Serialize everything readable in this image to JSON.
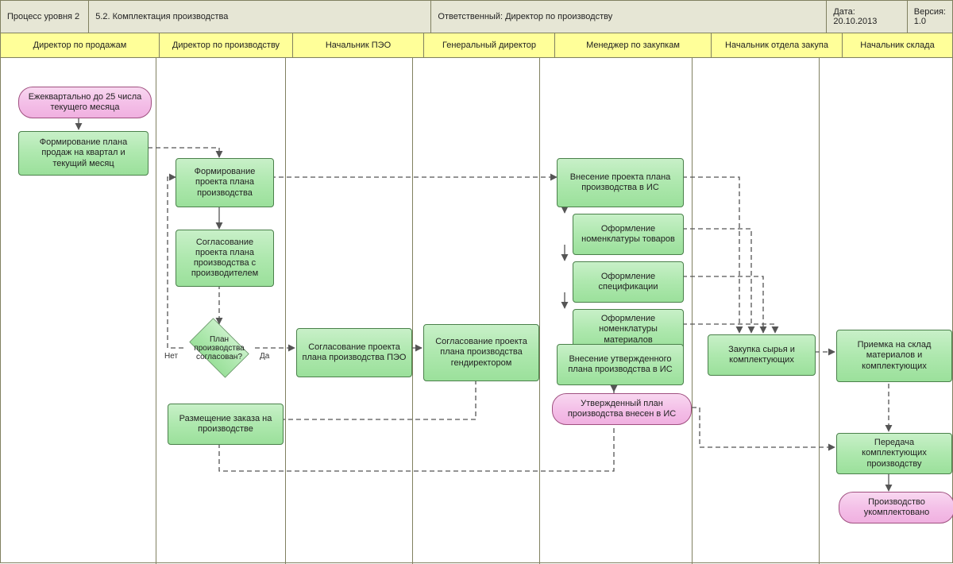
{
  "header": {
    "process_level_label": "Процесс уровня 2",
    "process_title": "5.2.  Комплектация производства",
    "responsible_label": "Ответственный: Директор по производству",
    "date_label": "Дата:",
    "date_value": "20.10.2013",
    "version_label": "Версия:",
    "version_value": "1.0"
  },
  "lanes": {
    "l0": "Директор по продажам",
    "l1": "Директор по производству",
    "l2": "Начальник ПЭО",
    "l3": "Генеральный директор",
    "l4": "Менеджер по закупкам",
    "l5": "Начальник отдела закупа",
    "l6": "Начальник склада"
  },
  "nodes": {
    "start_event": "Ежеквартально до 25 числа текущего месяца",
    "a_sales_plan": "Формирование плана продаж на квартал и текущий месяц",
    "b_project_plan": "Формирование проекта плана производства",
    "c_agree_producer": "Согласование проекта плана производства с производителем",
    "d_decision": "План производства согласован?",
    "d_yes": "Да",
    "d_no": "Нет",
    "e_place_order": "Размещение заказа на производстве",
    "f_agree_peo": "Согласование проекта плана производства ПЭО",
    "g_agree_gendir": "Согласование проекта плана производства гендиректором",
    "h_enter_project_is": "Внесение проекта плана производства в ИС",
    "i_nomenkl_goods": "Оформление номенклатуры товаров",
    "j_spec": "Оформление спецификации",
    "k_nomenkl_mat": "Оформление номенклатуры материалов",
    "l_enter_approved_is": "Внесение утвержденного плана производства в ИС",
    "l_event": "Утвержденный план производства внесен в ИС",
    "m_purchase": "Закупка сырья и комплектующих",
    "n_receive": "Приемка на склад материалов и комплектующих",
    "o_handover": "Передача комплектующих производству",
    "end_event": "Производство укомплектовано"
  }
}
